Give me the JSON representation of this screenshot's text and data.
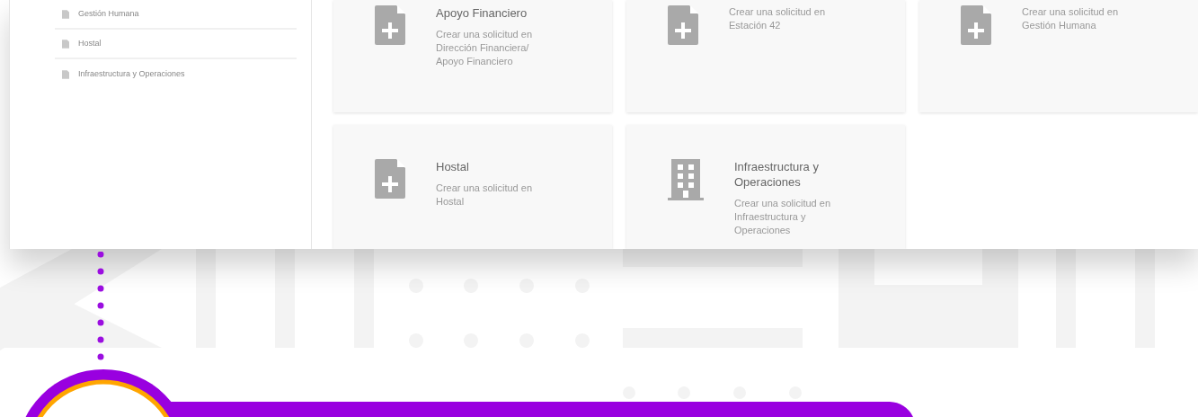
{
  "sidebar": {
    "items": [
      {
        "label": "Gestión Humana"
      },
      {
        "label": "Hostal"
      },
      {
        "label": "Infraestructura y Operaciones"
      }
    ]
  },
  "cards": [
    {
      "kind": "file-plus",
      "title": "Apoyo Financiero",
      "description": "Crear una solicitud en Dirección Financiera/ Apoyo Financiero"
    },
    {
      "kind": "file-plus",
      "description": "Crear una solicitud en Estación 42"
    },
    {
      "kind": "file-plus",
      "description": "Crear una solicitud en Gestión Humana"
    },
    {
      "kind": "file-plus",
      "title": "Hostal",
      "description": "Crear una solicitud en Hostal"
    },
    {
      "kind": "building",
      "title": "Infraestructura y Operaciones",
      "description": "Crear una solicitud en Infraestructura y Operaciones"
    }
  ]
}
